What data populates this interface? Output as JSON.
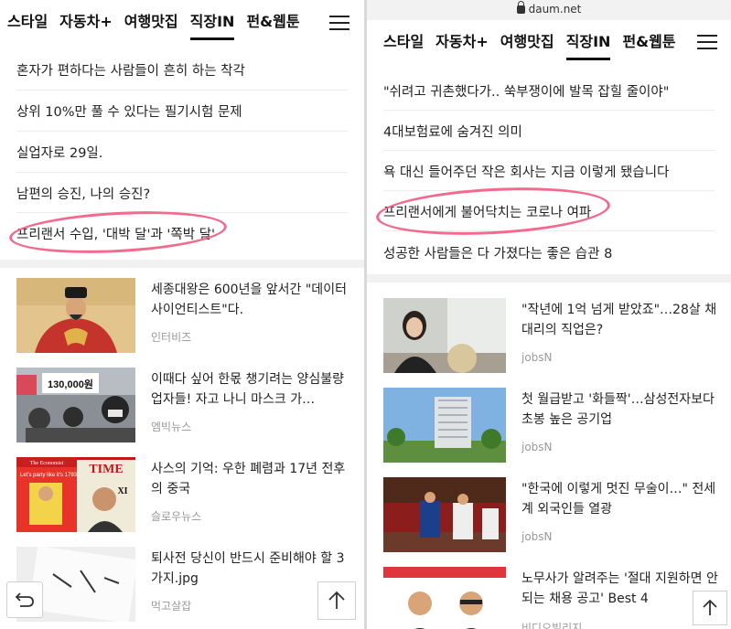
{
  "left": {
    "nav": {
      "tabs": [
        "스타일",
        "자동차+",
        "여행맛집",
        "직장IN",
        "펀&웹툰"
      ],
      "active_tab": "직장IN"
    },
    "headlines": [
      "혼자가 편하다는 사람들이 흔히 하는 착각",
      "상위 10%만 풀 수 있다는 필기시험 문제",
      "실업자로 29일.",
      "남편의 승진, 나의 승진?",
      "프리랜서 수입, '대박 달'과 '쪽박 달'"
    ],
    "cards": [
      {
        "title": "세종대왕은 600년을 앞서간 \"데이터 사이언티스트\"다.",
        "source": "인터비즈"
      },
      {
        "title": "이때다 싶어 한몫 챙기려는 양심불량 업자들! 자고 나니 마스크 가…",
        "source": "엠빅뉴스"
      },
      {
        "title": "사스의 기억: 우한 폐렴과 17년 전후의 중국",
        "source": "슬로우뉴스"
      },
      {
        "title": "퇴사전 당신이 반드시 준비해야 할 3가지.jpg",
        "source": "먹고살잡"
      }
    ],
    "thumb_text": {
      "price": "130,000원",
      "mag1_masthead": "The Economist",
      "mag1_headline": "Let's party like it's 1793",
      "mag2_masthead": "TIME",
      "mag2_label": "XI"
    }
  },
  "right": {
    "url": "daum.net",
    "nav": {
      "tabs": [
        "스타일",
        "자동차+",
        "여행맛집",
        "직장IN",
        "펀&웹툰"
      ],
      "active_tab": "직장IN"
    },
    "headlines": [
      "\"쉬려고 귀촌했다가.. 쑥부쟁이에 발목 잡힐 줄이야\"",
      "4대보험료에 숨겨진 의미",
      "욕 대신 들어주던 작은 회사는 지금 이렇게 됐습니다",
      "프리랜서에게 불어닥치는 코로나 여파",
      "성공한 사람들은 다 가졌다는 좋은 습관 8"
    ],
    "cards": [
      {
        "title": "\"작년에 1억 넘게 받았죠\"…28살 채 대리의 직업은?",
        "source": "jobsN"
      },
      {
        "title": "첫 월급받고 '화들짝'…삼성전자보다 초봉 높은 공기업",
        "source": "jobsN"
      },
      {
        "title": "\"한국에 이렇게 멋진 무술이…\" 전세계 외국인들 열광",
        "source": "jobsN"
      },
      {
        "title": "노무사가 알려주는 '절대 지원하면 안 되는 채용 공고' Best 4",
        "source": "비디오빌리지"
      }
    ]
  },
  "colors": {
    "highlight_circle": "#f26a8d",
    "separator": "#f1f1f1",
    "source_text": "#999999"
  },
  "icons": [
    "hamburger-menu-icon",
    "back-arrow-icon",
    "scroll-top-arrow-icon",
    "lock-icon"
  ]
}
